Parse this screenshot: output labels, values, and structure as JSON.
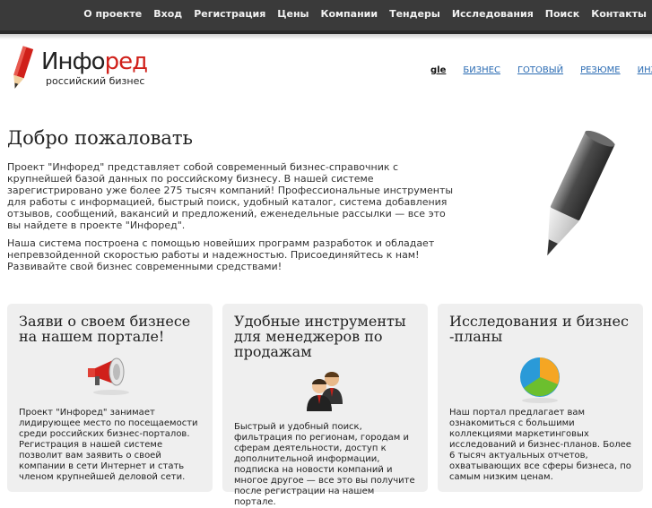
{
  "nav": {
    "items": [
      "О проекте",
      "Вход",
      "Регистрация",
      "Цены",
      "Компании",
      "Тендеры",
      "Исследования",
      "Поиск",
      "Контакты"
    ]
  },
  "logo": {
    "name_black": "Инфо",
    "name_red": "ред",
    "tagline": "российский бизнес"
  },
  "links": {
    "current": "gle",
    "items": [
      "БИЗНЕС",
      "ГОТОВЫЙ",
      "РЕЗЮМЕ",
      "ИНЖЕНЕР"
    ]
  },
  "main": {
    "title": "Добро пожаловать",
    "paragraph1": "Проект \"Инфоред\" представляет собой современный бизнес-справочник с крупнейшей базой данных по российскому бизнесу. В нашей системе зарегистрировано уже более 275 тысяч компаний! Профессиональные инструменты для работы с информацией, быстрый поиск, удобный каталог, система добавления отзывов, сообщений, вакансий и предложений, еженедельные рассылки — все это вы найдете в проекте \"Инфоред\".",
    "paragraph2": "Наша система построена с помощью новейших программ разработок и обладает непревзойденной скоростью работы и надежностью. Присоединяйтесь к нам! Развивайте свой бизнес современными средствами!"
  },
  "cards": [
    {
      "title": "Заяви о своем бизнесе на нашем портале!",
      "icon": "megaphone-icon",
      "text": "Проект \"Инфоред\" занимает лидирующее место по посещаемости среди российских бизнес-порталов. Регистрация в нашей системе позволит вам заявить о своей компании в сети Интернет и стать членом крупнейшей деловой сети."
    },
    {
      "title": "Удобные инструменты для менеджеров по продажам",
      "icon": "managers-icon",
      "text": "Быстрый и удобный поиск, фильтрация по регионам, городам и сферам деятельности, доступ к дополнительной информации, подписка на новости компаний и многое другое — все это вы получите после регистрации на нашем портале."
    },
    {
      "title": "Исследования и бизнес -планы",
      "icon": "pie-chart-icon",
      "text": "Наш портал предлагает вам ознакомиться с большими коллекциями маркетинговых исследований и бизнес-планов. Более 6 тысяч актуальных отчетов, охватывающих все сферы бизнеса, по самым низким ценам."
    }
  ],
  "colors": {
    "topbar": "#3a3a3a",
    "brand_red": "#d0201a",
    "link": "#2a6bb3",
    "card_bg": "#efefef"
  }
}
